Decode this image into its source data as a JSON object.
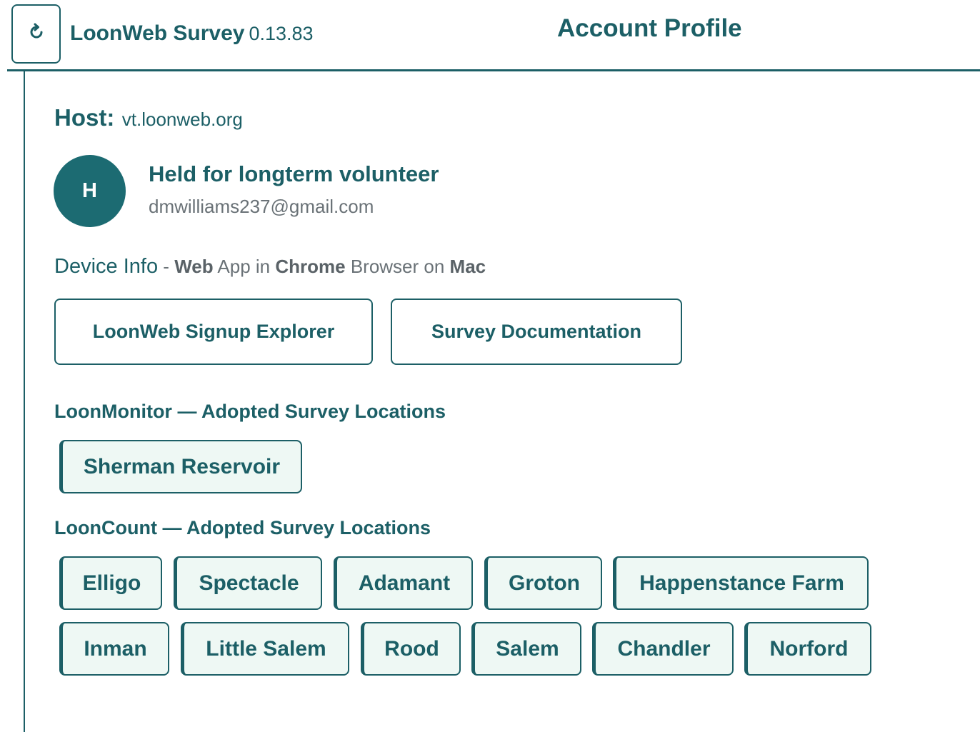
{
  "header": {
    "refresh_icon": "refresh-icon",
    "app_name": "LoonWeb Survey",
    "app_version": "0.13.83",
    "page_title": "Account Profile"
  },
  "host": {
    "label": "Host:",
    "value": "vt.loonweb.org"
  },
  "profile": {
    "avatar_initial": "H",
    "name": "Held for longterm volunteer",
    "email": "dmwilliams237@gmail.com"
  },
  "device": {
    "label": "Device Info",
    "separator": " - ",
    "app_type": "Web",
    "app_word": " App in ",
    "browser": "Chrome",
    "browser_word": " Browser on ",
    "os": "Mac"
  },
  "links": {
    "signup_explorer": "LoonWeb Signup Explorer",
    "survey_docs": "Survey Documentation"
  },
  "loon_monitor": {
    "heading": "LoonMonitor — Adopted Survey Locations",
    "locations": [
      "Sherman Reservoir"
    ]
  },
  "loon_count": {
    "heading": "LoonCount — Adopted Survey Locations",
    "locations": [
      "Elligo",
      "Spectacle",
      "Adamant",
      "Groton",
      "Happenstance Farm",
      "Inman",
      "Little Salem",
      "Rood",
      "Salem",
      "Chandler",
      "Norford"
    ]
  },
  "colors": {
    "primary": "#1c5f66",
    "chip_bg": "#eef8f4",
    "muted_text": "#6a7277"
  }
}
